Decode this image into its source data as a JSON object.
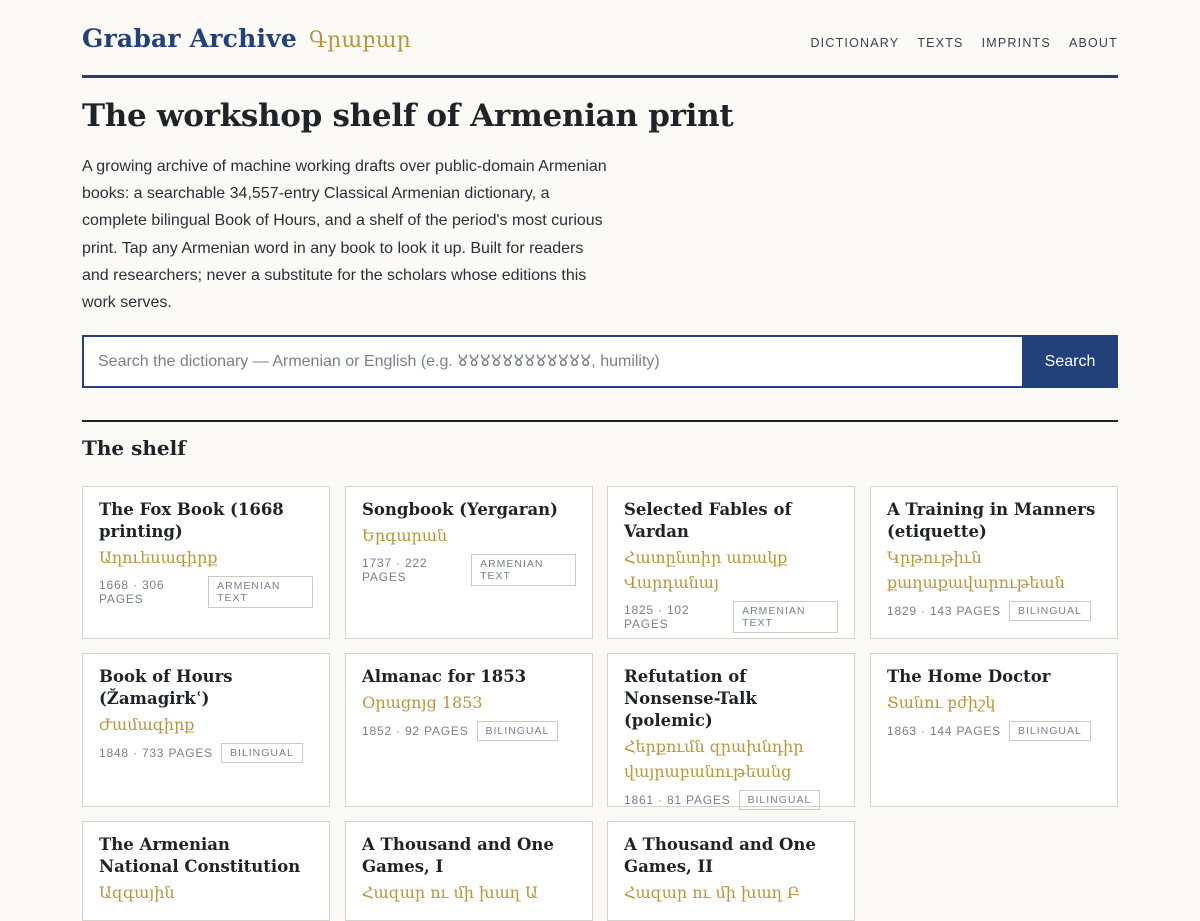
{
  "header": {
    "brand_name": "Grabar Archive",
    "brand_armenian": "Գրաբար",
    "nav": [
      "DICTIONARY",
      "TEXTS",
      "IMPRINTS",
      "ABOUT"
    ]
  },
  "hero": {
    "title": "The workshop shelf of Armenian print",
    "intro": "A growing archive of machine working drafts over public-domain Armenian books: a searchable 34,557-entry Classical Armenian dictionary, a complete bilingual Book of Hours, and a shelf of the period's most curious print. Tap any Armenian word in any book to look it up. Built for readers and researchers; never a substitute for the scholars whose editions this work serves."
  },
  "search": {
    "placeholder": "Search the dictionary — Armenian or English (e.g. 𑀫𑀫𑀫𑀫𑀫𑀫𑀫𑀫𑀫𑀫𑀫𑀫, humility)",
    "button_label": "Search"
  },
  "shelf": {
    "title": "The shelf",
    "books": [
      {
        "title": "The Fox Book (1668 printing)",
        "armenian": "Աղուեսագիրք",
        "meta": "1668 · 306 PAGES",
        "badge": "ARMENIAN TEXT"
      },
      {
        "title": "Songbook (Yergaran)",
        "armenian": "Երգարան",
        "meta": "1737 · 222 PAGES",
        "badge": "ARMENIAN TEXT"
      },
      {
        "title": "Selected Fables of Vardan",
        "armenian": "Հատընտիր առակք Վարդանայ",
        "meta": "1825 · 102 PAGES",
        "badge": "ARMENIAN TEXT"
      },
      {
        "title": "A Training in Manners (etiquette)",
        "armenian": "Կրթութիւն քաղաքավարութեան",
        "meta": "1829 · 143 PAGES",
        "badge": "BILINGUAL"
      },
      {
        "title": "Book of Hours (Žamagirkʿ)",
        "armenian": "Ժամագիրք",
        "meta": "1848 · 733 PAGES",
        "badge": "BILINGUAL"
      },
      {
        "title": "Almanac for 1853",
        "armenian": "Օրացոյց 1853",
        "meta": "1852 · 92 PAGES",
        "badge": "BILINGUAL"
      },
      {
        "title": "Refutation of Nonsense-Talk (polemic)",
        "armenian": "Հերքումն զրախնդիր վայրաբանութեանց",
        "meta": "1861 · 81 PAGES",
        "badge": "BILINGUAL"
      },
      {
        "title": "The Home Doctor",
        "armenian": "Տանու բժիշկ",
        "meta": "1863 · 144 PAGES",
        "badge": "BILINGUAL"
      },
      {
        "title": "The Armenian National Constitution",
        "armenian": "Ազգային",
        "meta": "",
        "badge": ""
      },
      {
        "title": "A Thousand and One Games, I",
        "armenian": "Հազար ու մի խաղ Ա",
        "meta": "",
        "badge": ""
      },
      {
        "title": "A Thousand and One Games, II",
        "armenian": "Հազար ու մի խաղ Բ",
        "meta": "",
        "badge": ""
      }
    ]
  }
}
